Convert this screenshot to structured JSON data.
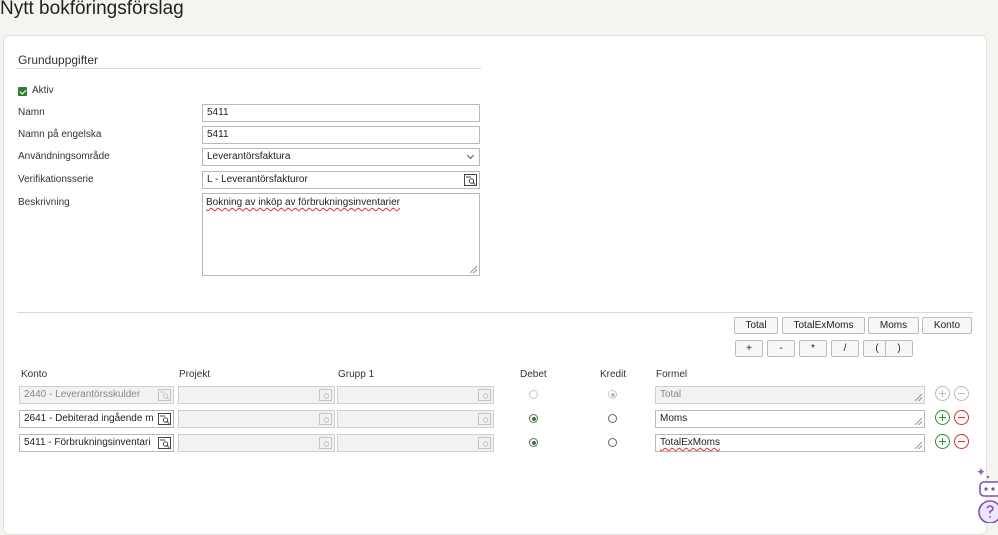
{
  "page": {
    "title": "Nytt bokföringsförslag"
  },
  "section": {
    "title": "Grunduppgifter"
  },
  "form": {
    "active_label": "Aktiv",
    "name_label": "Namn",
    "name_value": "5411",
    "name_en_label": "Namn på engelska",
    "name_en_value": "5411",
    "usage_label": "Användningsområde",
    "usage_value": "Leverantörsfaktura",
    "series_label": "Verifikationsserie",
    "series_value": "L - Leverantörsfakturor",
    "description_label": "Beskrivning",
    "description_value": "Bokning av  inköp av förbrukningsinventarier"
  },
  "formula_buttons": {
    "total": "Total",
    "totalexmoms": "TotalExMoms",
    "moms": "Moms",
    "konto": "Konto",
    "plus": "+",
    "minus": "-",
    "multiply": "*",
    "divide": "/",
    "paren_open": "(",
    "paren_close": ")"
  },
  "table": {
    "headers": {
      "konto": "Konto",
      "projekt": "Projekt",
      "grupp": "Grupp 1",
      "debet": "Debet",
      "kredit": "Kredit",
      "formel": "Formel"
    },
    "rows": [
      {
        "konto": "2440 - Leverantörsskulder",
        "formel": "Total",
        "debit": false,
        "disabled": true
      },
      {
        "konto": "2641 - Debiterad ingående m",
        "formel": "Moms",
        "debit": true,
        "disabled": false
      },
      {
        "konto": "5411 - Förbrukningsinventari",
        "formel": "TotalExMoms",
        "debit": true,
        "disabled": false
      }
    ]
  },
  "colors": {
    "accent": "#2e7d32",
    "danger": "#d32f2f"
  }
}
